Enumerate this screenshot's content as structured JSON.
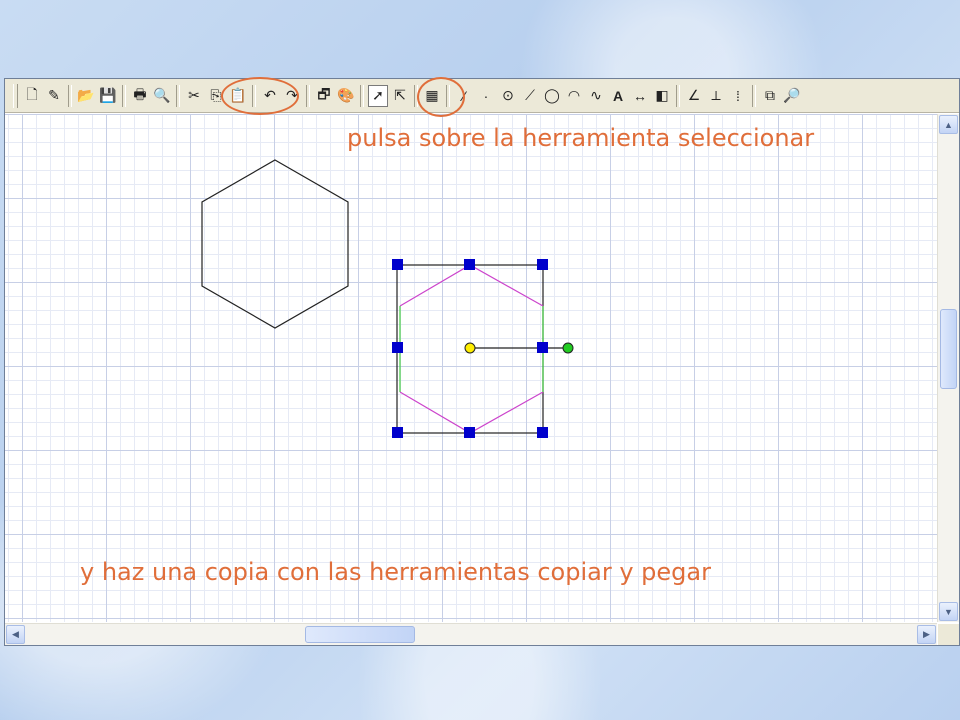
{
  "annotations": {
    "top": "pulsa sobre la herramienta seleccionar",
    "bottom": "y haz una copia con las herramientas copiar y pegar",
    "color": "#e06e3a"
  },
  "toolbar": {
    "groups": [
      [
        "new-document-icon",
        "properties-icon"
      ],
      [
        "open-folder-icon",
        "save-icon"
      ],
      [
        "print-icon",
        "print-preview-icon"
      ],
      [
        "cut-icon",
        "copy-icon",
        "paste-icon"
      ],
      [
        "undo-icon",
        "redo-icon"
      ],
      [
        "object-properties-icon",
        "style-icon"
      ],
      [
        "select-arrow-icon",
        "select-point-icon"
      ],
      [
        "table-icon"
      ],
      [
        "segment-icon",
        "point-icon",
        "circle-point-icon",
        "line-icon",
        "circle-icon",
        "arc-icon",
        "curve-icon",
        "text-icon",
        "measure-icon",
        "fill-icon"
      ],
      [
        "angle-icon",
        "perpendicular-icon",
        "grid-points-icon"
      ],
      [
        "group-icon",
        "zoom-icon"
      ]
    ],
    "highlighted": [
      "copy-icon",
      "paste-icon",
      "select-arrow-icon"
    ]
  },
  "shapes": {
    "outline_color": "#000000",
    "selection_handle_color": "#0000cc",
    "edge_color_magenta": "#cc44cc",
    "edge_color_green": "#44cc44",
    "rotation_center_color": "#ffee00",
    "rotation_handle_color": "#22cc22"
  }
}
